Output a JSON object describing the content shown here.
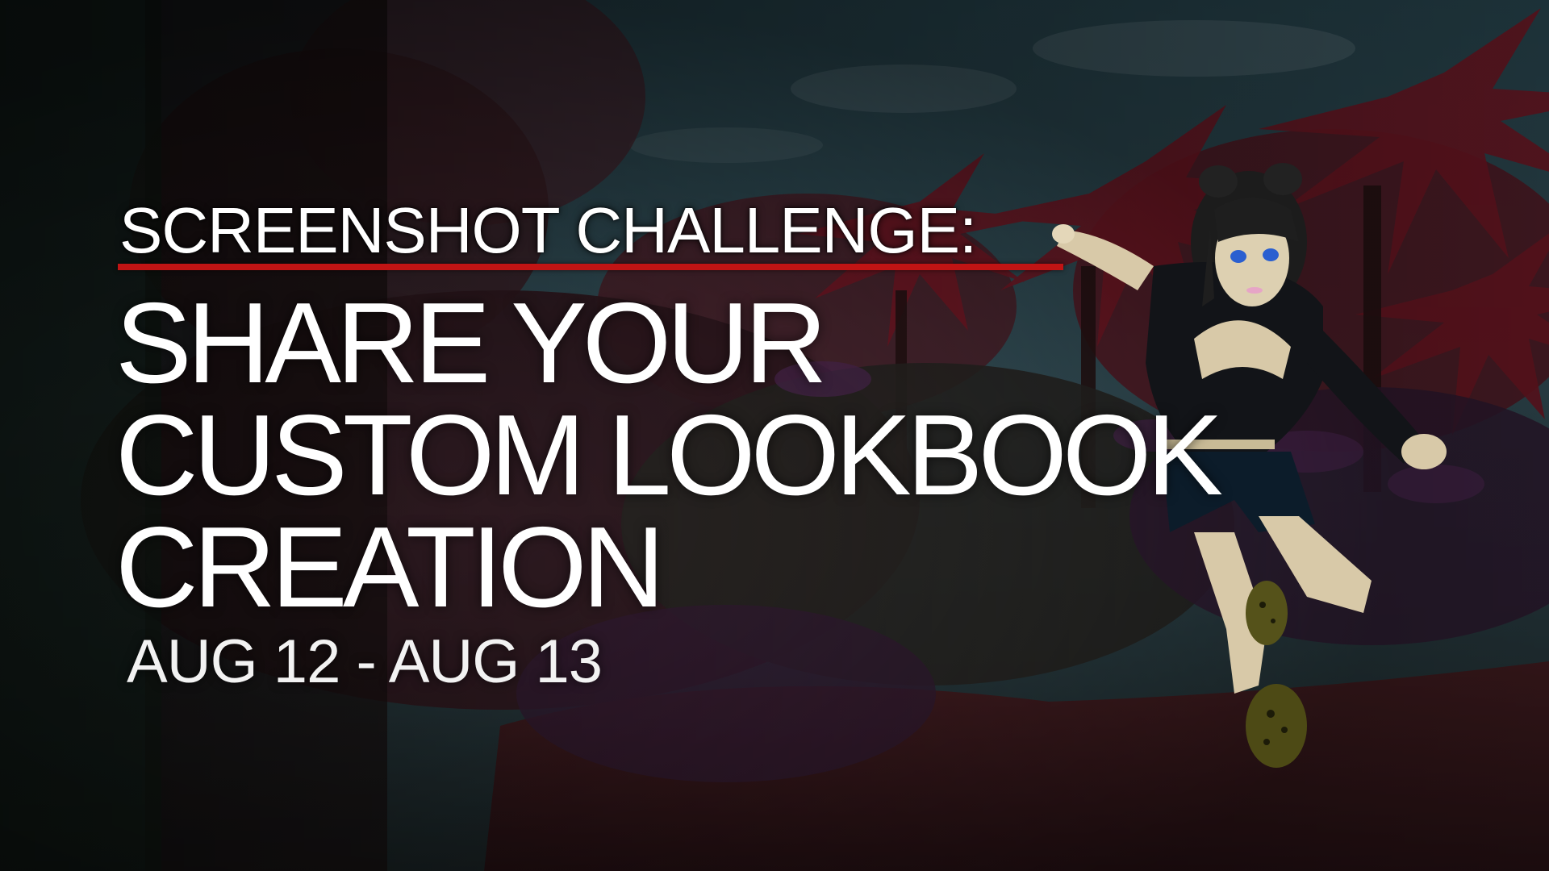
{
  "banner": {
    "title": "SCREENSHOT CHALLENGE:",
    "headline_lines": [
      "SHARE YOUR",
      "CUSTOM LOOKBOOK",
      "CREATION"
    ],
    "dates": "AUG 12 - AUG 13"
  },
  "colors": {
    "accent_red": "#c01414",
    "text": "#ffffff"
  },
  "icons": [
    "avatar-character",
    "jungle-background"
  ]
}
